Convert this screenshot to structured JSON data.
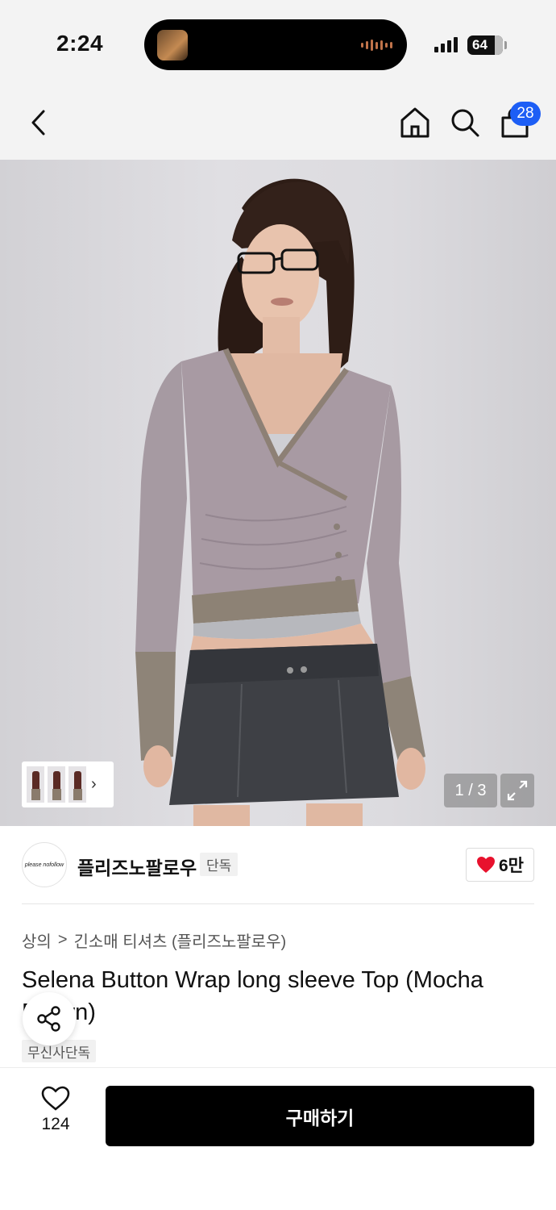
{
  "status_bar": {
    "time": "2:24",
    "battery": "64"
  },
  "nav": {
    "back_icon": "chevron-left-icon",
    "home_icon": "home-icon",
    "search_icon": "search-icon",
    "cart_icon": "shopping-bag-icon",
    "cart_count": "28"
  },
  "gallery": {
    "page_indicator": "1 / 3",
    "expand_icon": "expand-icon",
    "thumbnail_chevron": "›"
  },
  "brand": {
    "logo_text": "please nofollow",
    "name": "플리즈노팔로우",
    "tag": "단독",
    "likes": "6만",
    "heart_color": "#e8112d"
  },
  "product": {
    "breadcrumb": [
      "상의",
      "긴소매 티셔츠 (플리즈노팔로우)"
    ],
    "breadcrumb_separator": ">",
    "title": "Selena Button Wrap long sleeve Top (Mocha Brown)",
    "exclusive_tag": "무신사단독"
  },
  "bottom_bar": {
    "wish_count": "124",
    "buy_label": "구매하기"
  },
  "colors": {
    "badge": "#1d5ef5",
    "buy_button": "#000000"
  }
}
